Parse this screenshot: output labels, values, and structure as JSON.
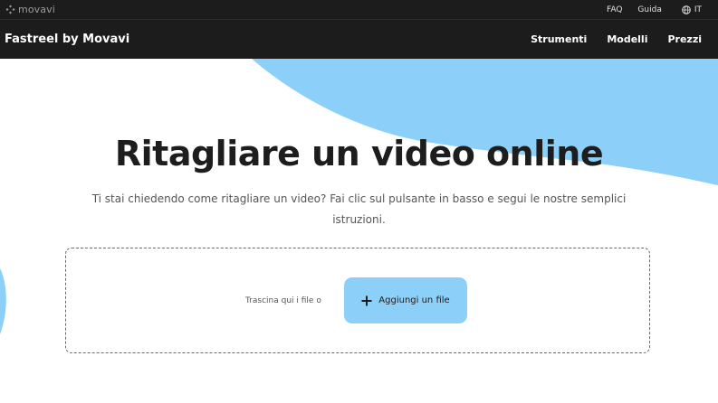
{
  "topbar": {
    "brand": "movavi",
    "links": {
      "faq": "FAQ",
      "guida": "Guida"
    },
    "language": "IT"
  },
  "navbar": {
    "title": "Fastreel by Movavi",
    "items": [
      "Strumenti",
      "Modelli",
      "Prezzi"
    ]
  },
  "hero": {
    "title": "Ritagliare un video online",
    "subtitle_line1": "Ti stai chiedendo come ritagliare un video? Fai clic sul pulsante in basso e segui le nostre semplici",
    "subtitle_line2": "istruzioni."
  },
  "upload": {
    "drop_text": "Trascina qui i file o",
    "button_label": "Aggiungi un file"
  },
  "colors": {
    "header_bg": "#1c1c1c",
    "accent_blue": "#8ccff8",
    "title_text": "#1d1d1d"
  }
}
